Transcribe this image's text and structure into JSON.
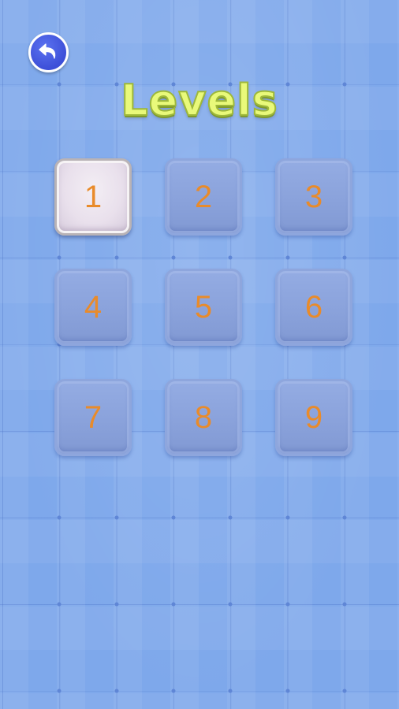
{
  "screen": {
    "title": "Levels",
    "background_color": "#7fa9ec",
    "accent_title_color": "#e9f97a"
  },
  "back_button": {
    "icon": "undo-arrow-icon",
    "color": "#3d4fd8"
  },
  "levels": [
    {
      "label": "1",
      "state": "unlocked"
    },
    {
      "label": "2",
      "state": "locked"
    },
    {
      "label": "3",
      "state": "locked"
    },
    {
      "label": "4",
      "state": "locked"
    },
    {
      "label": "5",
      "state": "locked"
    },
    {
      "label": "6",
      "state": "locked"
    },
    {
      "label": "7",
      "state": "locked"
    },
    {
      "label": "8",
      "state": "locked"
    },
    {
      "label": "9",
      "state": "locked"
    }
  ],
  "level_number_color": "#e98b2a"
}
